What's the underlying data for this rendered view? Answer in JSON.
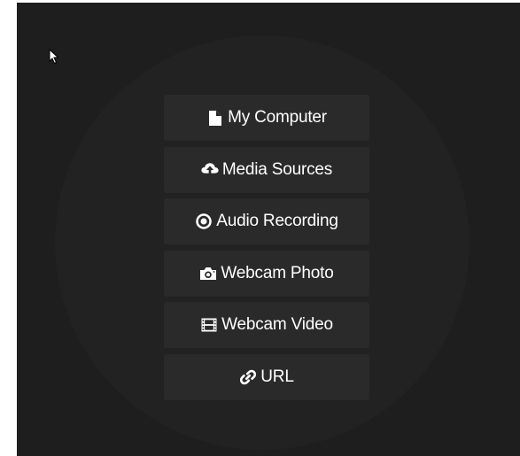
{
  "theme": {
    "panel_background": "#1e1e1e",
    "circle_background": "#222222",
    "button_background": "#2a2a2a",
    "text_color": "#ffffff"
  },
  "cursor": {
    "icon": "arrow-pointer-icon"
  },
  "menu": {
    "items": [
      {
        "label": "My Computer",
        "icon": "file-icon"
      },
      {
        "label": "Media Sources",
        "icon": "cloud-upload-icon"
      },
      {
        "label": "Audio Recording",
        "icon": "record-circle-icon"
      },
      {
        "label": "Webcam Photo",
        "icon": "camera-icon"
      },
      {
        "label": "Webcam Video",
        "icon": "film-icon"
      },
      {
        "label": "URL",
        "icon": "link-icon"
      }
    ]
  }
}
